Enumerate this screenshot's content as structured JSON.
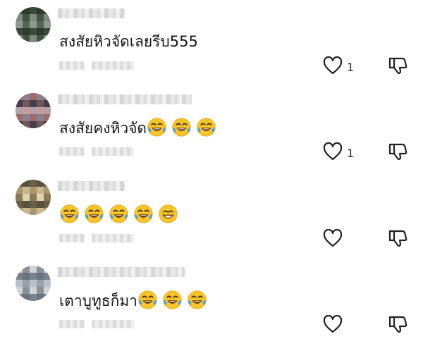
{
  "comments": [
    {
      "text": "สงสัยหิวจัดเลยรีบ555",
      "emojis": [],
      "like_count": "1",
      "avatar_colors": [
        "#3a4a3a",
        "#556655",
        "#7f8a7f",
        "#2e3a2e",
        "#90988f",
        "#445244"
      ]
    },
    {
      "text": "สงสัยคงหิวจัด",
      "emojis": [
        "face-with-tears-of-joy-icon",
        "face-with-tears-of-joy-icon",
        "face-with-tears-of-joy-icon"
      ],
      "like_count": "1",
      "avatar_colors": [
        "#6e5a5a",
        "#a06a6a",
        "#c89a9a",
        "#4a3d4a",
        "#8a8090",
        "#b0a0a8"
      ]
    },
    {
      "text": "",
      "emojis": [
        "face-with-tears-of-joy-icon",
        "face-with-tears-of-joy-icon",
        "face-with-tears-of-joy-icon",
        "face-with-tears-of-joy-icon",
        "grinning-face-icon"
      ],
      "like_count": "",
      "avatar_colors": [
        "#8a7a5a",
        "#c8b88a",
        "#6a5e44",
        "#e0d4b0",
        "#a89870",
        "#5a5040"
      ]
    },
    {
      "text": "เตาบูทูธก็มา",
      "emojis": [
        "face-with-tears-of-joy-icon",
        "face-with-tears-of-joy-icon",
        "face-with-tears-of-joy-icon"
      ],
      "like_count": "",
      "avatar_colors": [
        "#8a9098",
        "#b8c0c8",
        "#6a7480",
        "#d0d4d8",
        "#9aa0a8",
        "#7a828c"
      ]
    }
  ],
  "colors": {
    "emoji_face": "#f7c52a",
    "emoji_tear": "#4aa3e0",
    "icon_stroke": "#222222"
  }
}
